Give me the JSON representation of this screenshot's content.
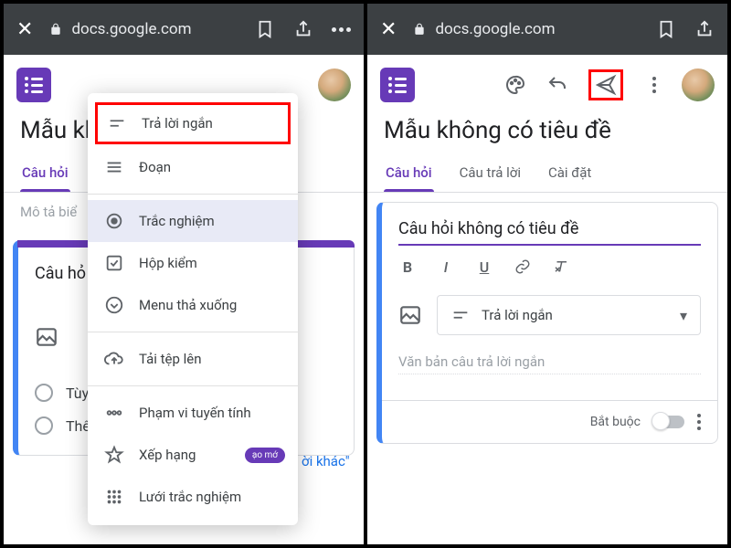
{
  "browser": {
    "url": "docs.google.com"
  },
  "form": {
    "title_truncated": "Mẫu khô",
    "title_full": "Mẫu không có tiêu đề",
    "description": "Mô tả biể"
  },
  "tabs": {
    "questions": "Câu hỏi",
    "responses": "Câu trả lời",
    "settings": "Cài đặt"
  },
  "left": {
    "question_placeholder": "Câu hỏ",
    "opt1": "Tùy c",
    "opt2": "Thên",
    "other_quoted": "ời khác\""
  },
  "menu": {
    "short_answer": "Trả lời ngắn",
    "paragraph": "Đoạn",
    "multiple_choice": "Trắc nghiệm",
    "checkbox": "Hộp kiểm",
    "dropdown": "Menu thả xuống",
    "file_upload": "Tải tệp lên",
    "linear_scale": "Phạm vi tuyến tính",
    "rating": "Xếp hạng",
    "grid": "Lưới trắc nghiệm",
    "badge": "ạo mớ"
  },
  "right": {
    "question_title": "Câu hỏi không có tiêu đề",
    "selected_type": "Trả lời ngắn",
    "answer_hint": "Văn bản câu trả lời ngắn",
    "required_label": "Bắt buộc"
  }
}
